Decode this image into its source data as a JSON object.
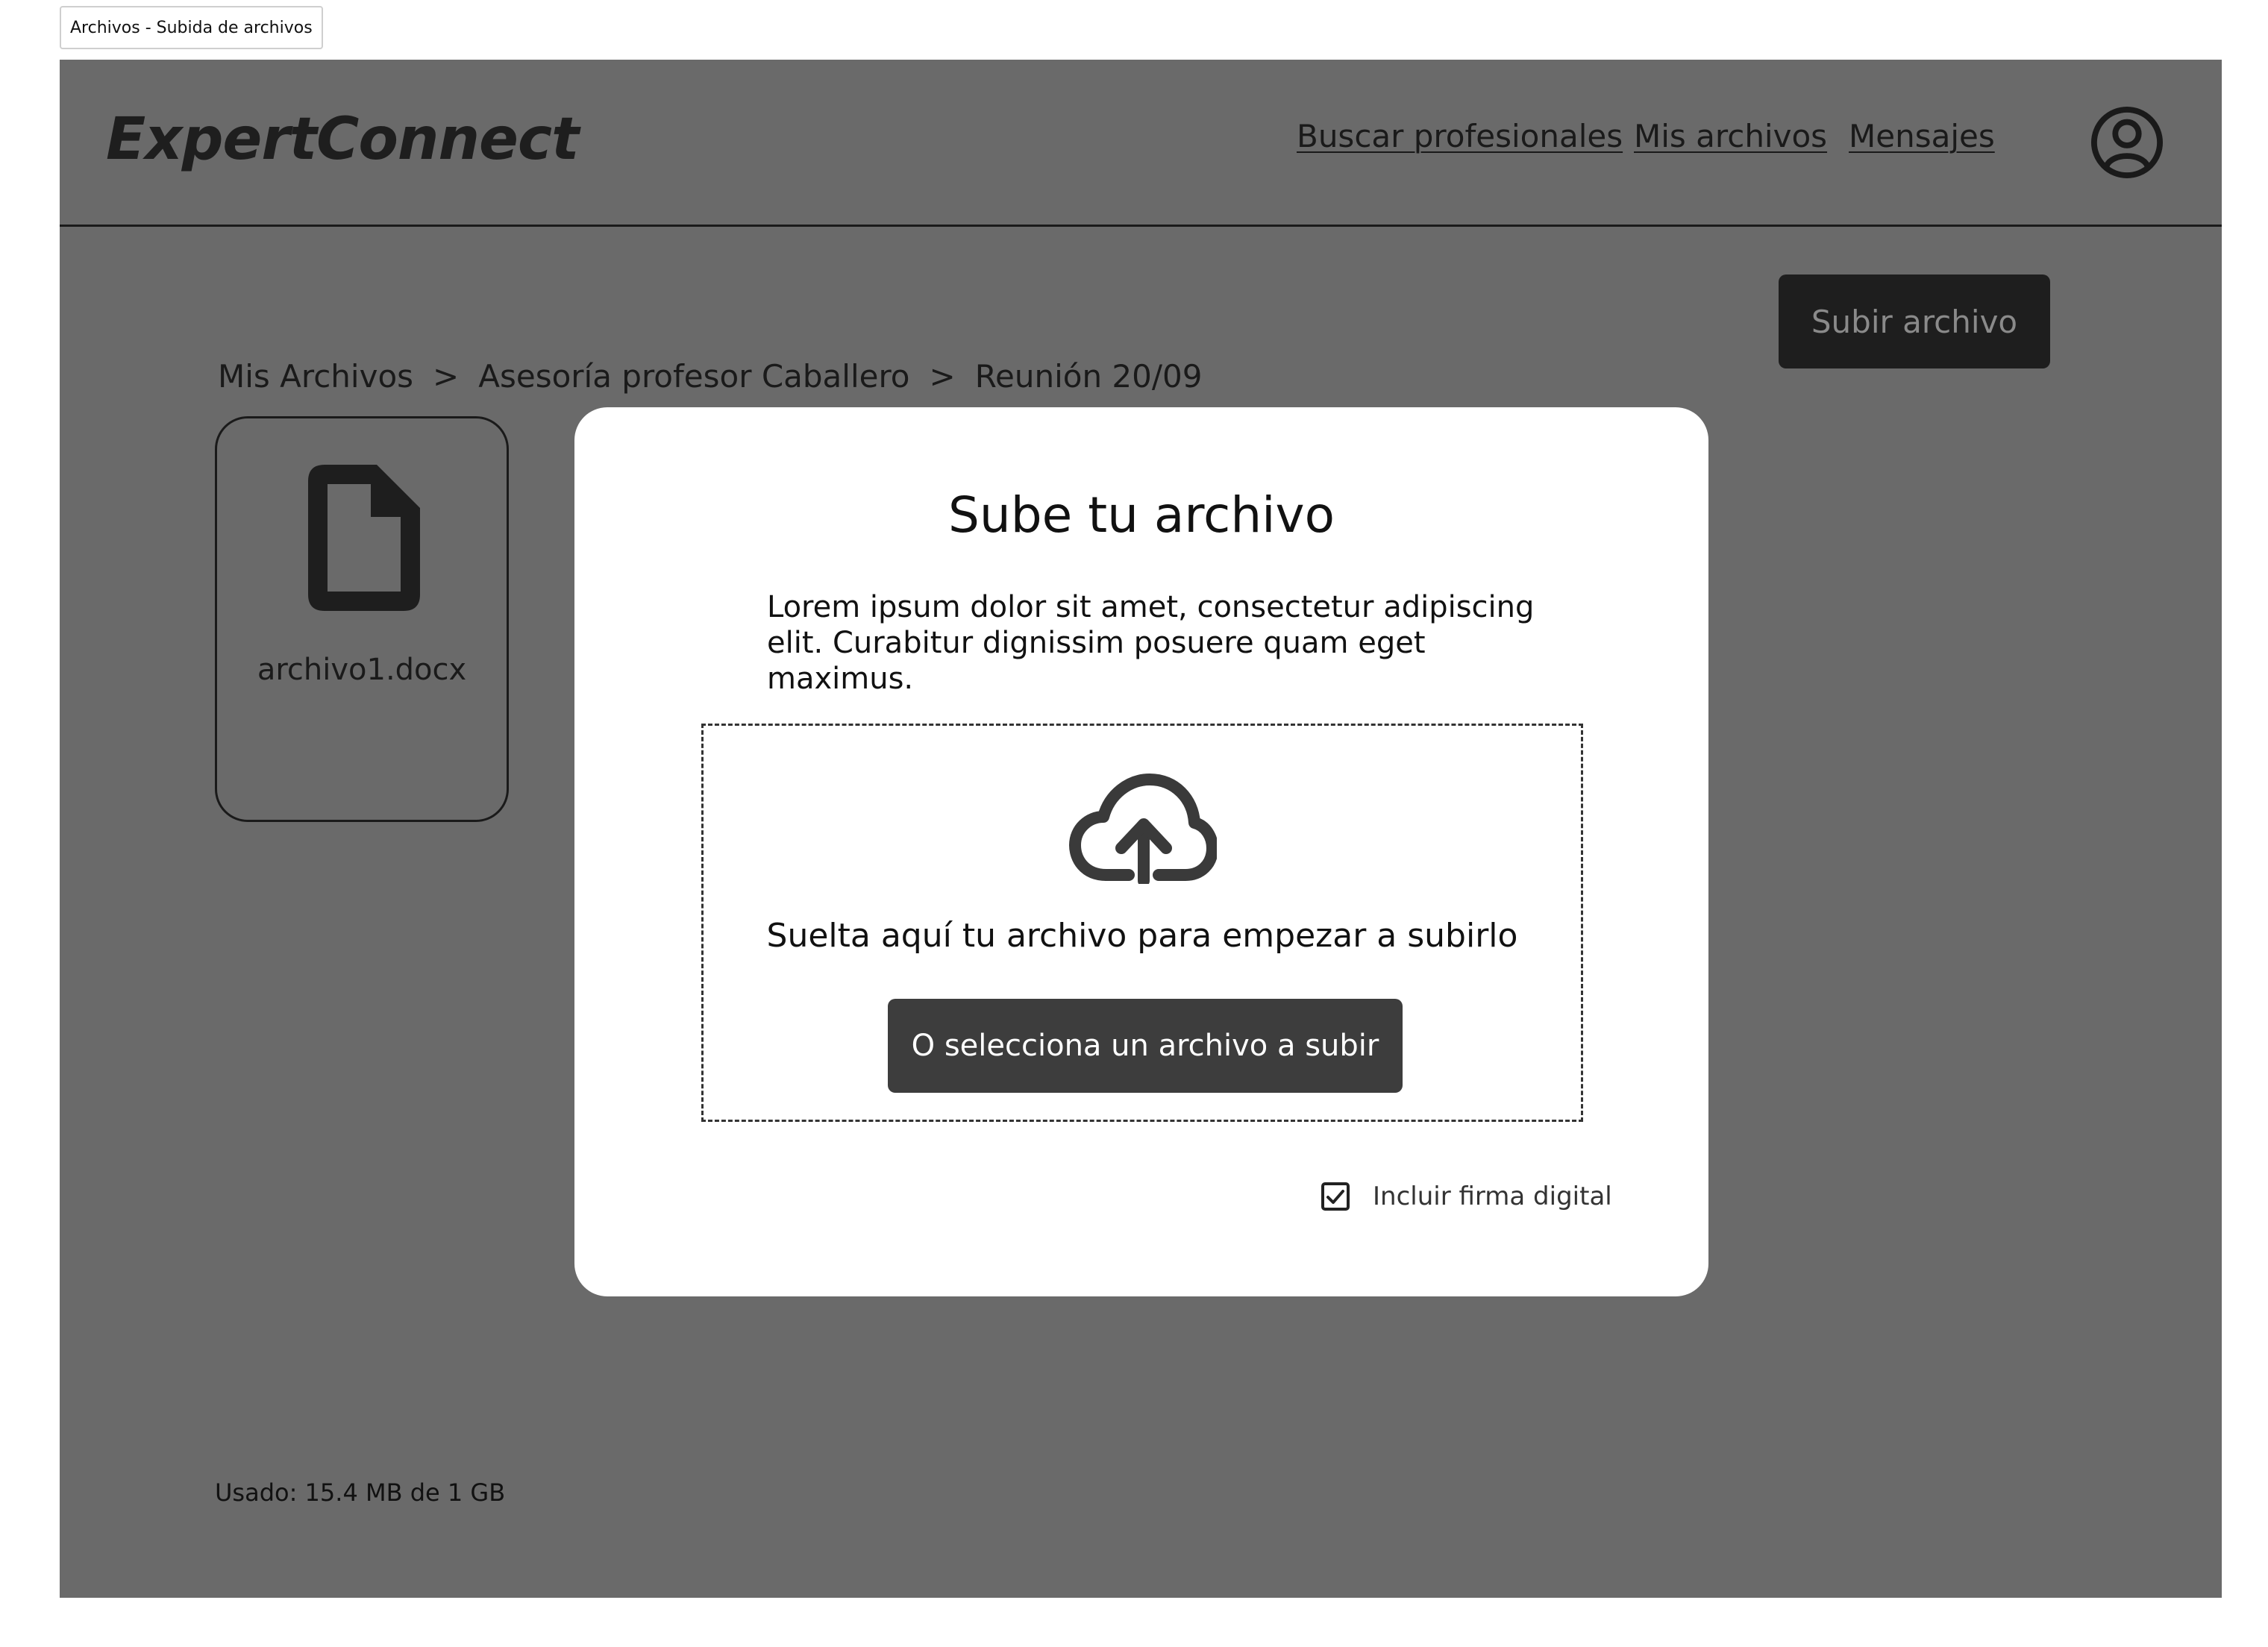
{
  "frame": {
    "label": "Archivos - Subida de archivos"
  },
  "header": {
    "logo": "ExpertConnect",
    "nav": [
      {
        "label": "Buscar profesionales"
      },
      {
        "label": "Mis archivos"
      },
      {
        "label": "Mensajes"
      }
    ],
    "avatar_icon": "user-circle-icon"
  },
  "breadcrumb": {
    "items": [
      "Mis Archivos",
      "Asesoría profesor Caballero",
      "Reunión 20/09"
    ],
    "separator": ">"
  },
  "toolbar": {
    "upload_label": "Subir archivo"
  },
  "files": [
    {
      "name": "archivo1.docx",
      "icon": "document-icon"
    }
  ],
  "storage": {
    "usage_text": "Usado: 15.4 MB de 1 GB"
  },
  "modal": {
    "title": "Sube tu archivo",
    "description_line1": "Lorem ipsum dolor sit amet, consectetur adipiscing",
    "description_line2": "elit. Curabitur dignissim posuere quam eget maximus.",
    "dropzone_icon": "cloud-upload-icon",
    "dropzone_text": "Suelta aquí tu archivo para empezar a subirlo",
    "select_button": "O selecciona un archivo a subir",
    "checkbox_label": "Incluir firma digital",
    "checkbox_checked": true
  },
  "colors": {
    "overlay_bg": "#6a6a6a",
    "dark_button": "#1e1e1e",
    "select_button": "#3d3d3d",
    "modal_bg": "#ffffff"
  }
}
